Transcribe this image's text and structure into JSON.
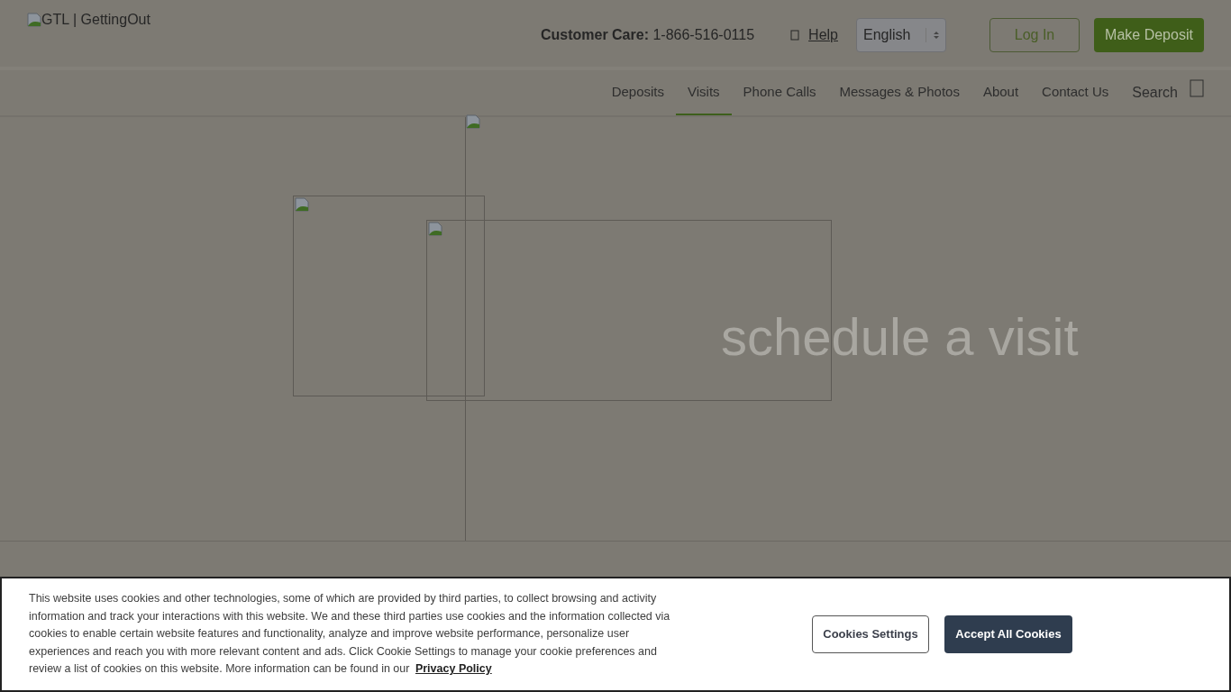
{
  "header": {
    "logo_alt": "GTL | GettingOut",
    "customer_care_label": "Customer Care:",
    "customer_care_phone": "1-866-516-0115",
    "help": "Help",
    "language": "English",
    "login": "Log In",
    "deposit": "Make Deposit"
  },
  "nav": [
    {
      "label": "Deposits",
      "selected": false
    },
    {
      "label": "Visits",
      "selected": true
    },
    {
      "label": "Phone Calls",
      "selected": false
    },
    {
      "label": "Messages & Photos",
      "selected": false
    },
    {
      "label": "About",
      "selected": false
    },
    {
      "label": "Contact Us",
      "selected": false
    }
  ],
  "search": "Search",
  "hero": {
    "heading": "schedule a visit"
  },
  "cookie_banner": {
    "text": "This website uses cookies and other technologies, some of which are provided by third parties, to collect browsing and activity information and track your interactions with this website. We and these third parties use cookies and the information collected via cookies to enable certain website features and functionality, analyze and improve website performance, personalize user experiences and reach you with more relevant content and ads. Click Cookie Settings to manage your cookie preferences and review a list of cookies on this website. More information can be found in our",
    "link": "Privacy Policy",
    "settings_button": "Cookies Settings",
    "accept_button": "Accept All Cookies"
  }
}
